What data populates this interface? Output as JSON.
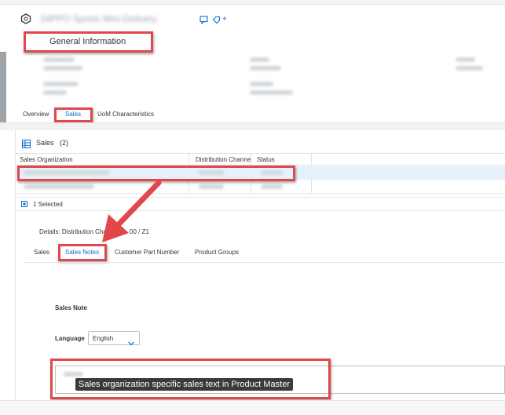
{
  "header": {
    "title_blurred": "DIPPO Sports Mini Delivery",
    "add_symbol": "+"
  },
  "general_info": {
    "label": "General Information"
  },
  "tabs": [
    {
      "label": "Overview",
      "active": false
    },
    {
      "label": "Sales",
      "active": true
    },
    {
      "label": "UoM Characteristics",
      "active": false
    }
  ],
  "sales_table": {
    "title": "Sales",
    "count": "(2)",
    "columns": [
      "Sales Organization",
      "Distribution Channe",
      "Status"
    ],
    "selection_label": "1 Selected"
  },
  "details": {
    "label_prefix": "Details: Distribution Chain",
    "label_suffix": "00 / Z1",
    "tabs": [
      {
        "label": "Sales",
        "active": false
      },
      {
        "label": "Sales Notes",
        "active": true
      },
      {
        "label": "Customer Part Number",
        "active": false
      },
      {
        "label": "Product Groups",
        "active": false
      }
    ]
  },
  "sales_note": {
    "section_label": "Sales Note",
    "language_label": "Language",
    "language_value": "English",
    "callout": "Sales organization specific sales text in Product Master"
  },
  "colors": {
    "accent": "#0a6ed1",
    "highlight": "#e0484b",
    "selected_row": "#e5f0fa"
  }
}
